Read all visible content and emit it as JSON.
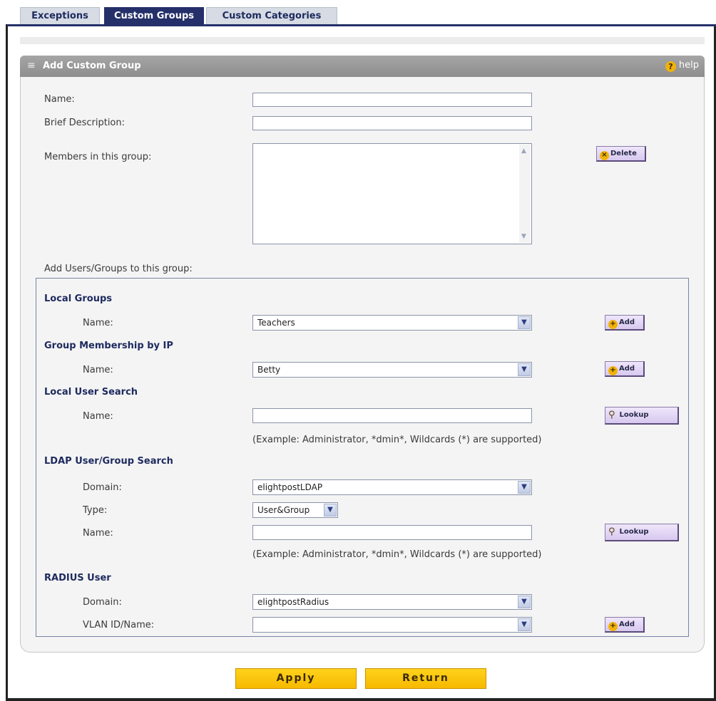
{
  "tabs": [
    {
      "label": "Exceptions"
    },
    {
      "label": "Custom Groups"
    },
    {
      "label": "Custom Categories"
    }
  ],
  "active_tab": "Custom Groups",
  "section": {
    "title": "Add Custom Group",
    "help": "help"
  },
  "form": {
    "name_label": "Name:",
    "name_value": "",
    "desc_label": "Brief Description:",
    "desc_value": "",
    "members_label": "Members in this group:",
    "delete_label": "Delete",
    "add_users_label": "Add Users/Groups to this group:"
  },
  "local_groups": {
    "heading": "Local Groups",
    "name_label": "Name:",
    "value": "Teachers",
    "add_label": "Add"
  },
  "group_ip": {
    "heading": "Group Membership by IP",
    "name_label": "Name:",
    "value": "Betty",
    "add_label": "Add"
  },
  "local_user": {
    "heading": "Local User Search",
    "name_label": "Name:",
    "value": "",
    "lookup_label": "Lookup",
    "example": "(Example: Administrator, *dmin*, Wildcards (*) are supported)"
  },
  "ldap": {
    "heading": "LDAP User/Group Search",
    "domain_label": "Domain:",
    "domain_value": "elightpostLDAP",
    "type_label": "Type:",
    "type_value": "User&Group",
    "name_label": "Name:",
    "name_value": "",
    "lookup_label": "Lookup",
    "example": "(Example: Administrator, *dmin*, Wildcards (*) are supported)"
  },
  "radius": {
    "heading": "RADIUS User",
    "domain_label": "Domain:",
    "domain_value": "elightpostRadius",
    "vlan_label": "VLAN ID/Name:",
    "vlan_value": "",
    "add_label": "Add"
  },
  "actions": {
    "apply": "Apply",
    "return": "Return"
  },
  "colors": {
    "tab_active": "#25306a",
    "header_grey": "#9a9a9a",
    "button_yellow": "#f7b900",
    "small_button": "#dccdf1"
  }
}
